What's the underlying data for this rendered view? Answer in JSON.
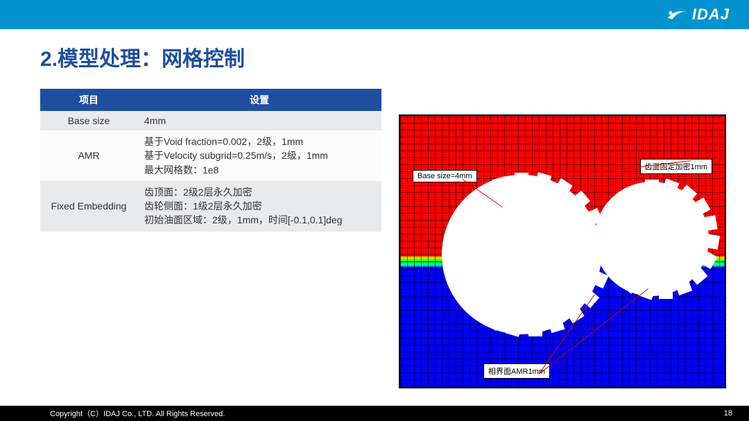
{
  "brand": "IDAJ",
  "title": "2.模型处理：网格控制",
  "table": {
    "headers": [
      "项目",
      "设置"
    ],
    "rows": [
      {
        "item": "Base size",
        "value": "4mm"
      },
      {
        "item": "AMR",
        "value": "基于Void fraction=0.002，2级，1mm\n基于Velocity subgrid=0.25m/s，2级，1mm\n最大网格数：1e8"
      },
      {
        "item": "Fixed Embedding",
        "value": "齿顶面：2级2层永久加密\n齿轮侧面：1级2层永久加密\n初始油面区域：2级，1mm，时间[-0.1,0.1]deg"
      }
    ]
  },
  "figure": {
    "label_base": "Base size=4mm",
    "label_fixed": "齿面固定加密1mm",
    "label_amr": "相界面AMR1mm"
  },
  "footer": {
    "copyright": "Copyright（C）IDAJ Co., LTD. All Rights Reserved.",
    "page": "18"
  }
}
